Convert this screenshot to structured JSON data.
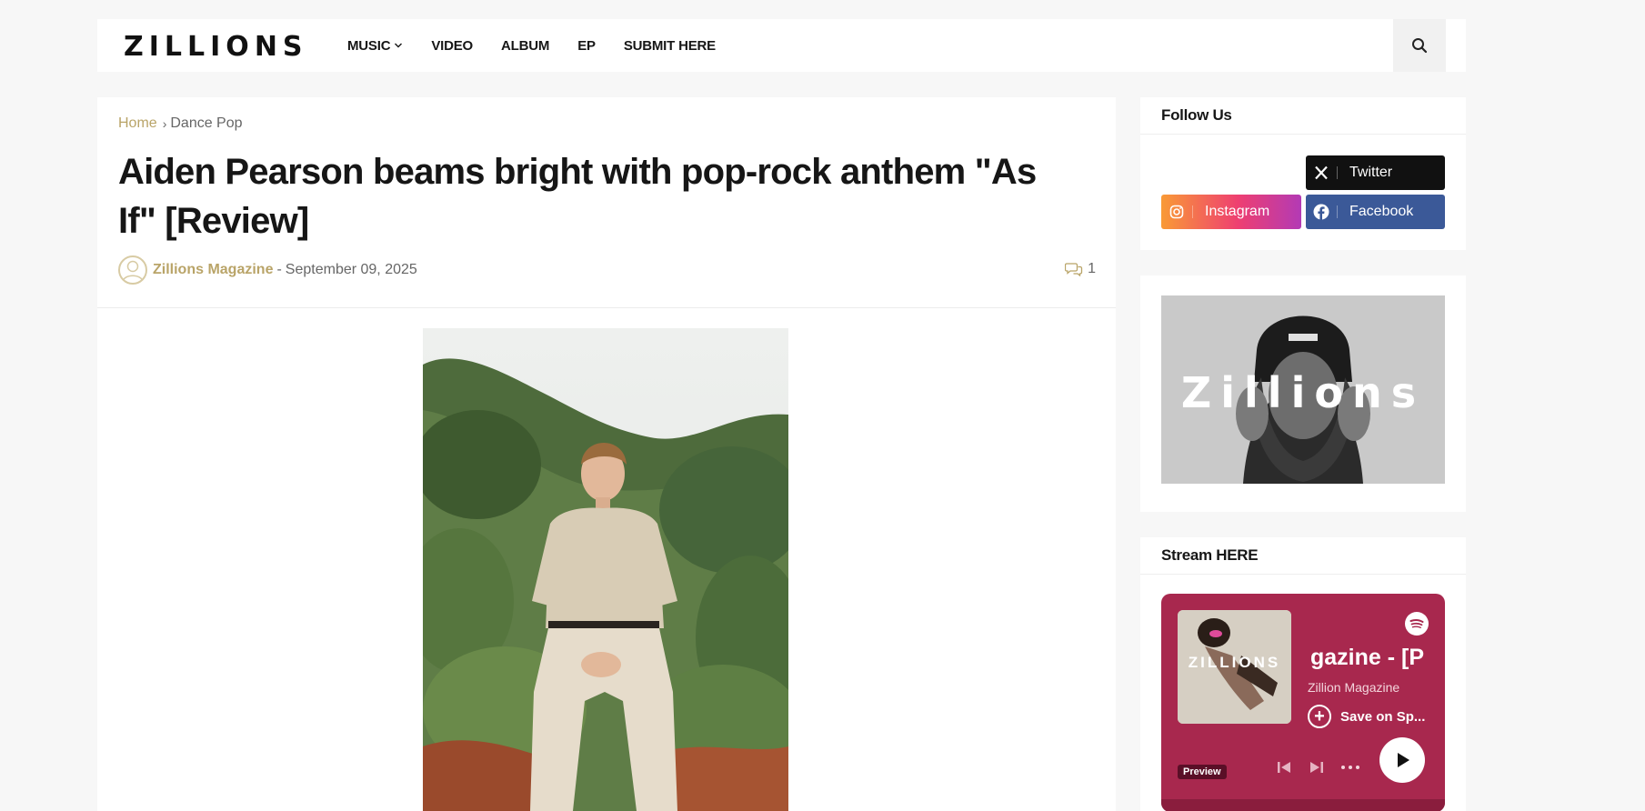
{
  "header": {
    "logo": "ZILLIONS",
    "nav": [
      {
        "label": "MUSIC",
        "has_dropdown": true
      },
      {
        "label": "VIDEO"
      },
      {
        "label": "ALBUM"
      },
      {
        "label": "EP"
      },
      {
        "label": "SUBMIT HERE"
      }
    ],
    "search_icon": "search-icon"
  },
  "article": {
    "breadcrumb": {
      "home": "Home",
      "separator": "›",
      "current": "Dance Pop"
    },
    "title": "Aiden Pearson beams bright with pop-rock anthem \"As If\" [Review]",
    "author": "Zillions Magazine",
    "date_prefix": "-",
    "date": "September 09, 2025",
    "comments_count": "1"
  },
  "sidebar": {
    "follow": {
      "title": "Follow Us",
      "twitter": "Twitter",
      "instagram": "Instagram",
      "facebook": "Facebook"
    },
    "banner": {
      "text": "Zillions"
    },
    "stream": {
      "title": "Stream HERE",
      "art_text": "ZILLIONS",
      "track_title": "gazine - [P",
      "artist": "Zillion Magazine",
      "save_label": "Save on Sp...",
      "preview_badge": "Preview"
    }
  },
  "colors": {
    "accent_gold": "#b9a468",
    "spotify_bg": "#a8284e",
    "facebook": "#3b5998",
    "twitter": "#111111"
  }
}
